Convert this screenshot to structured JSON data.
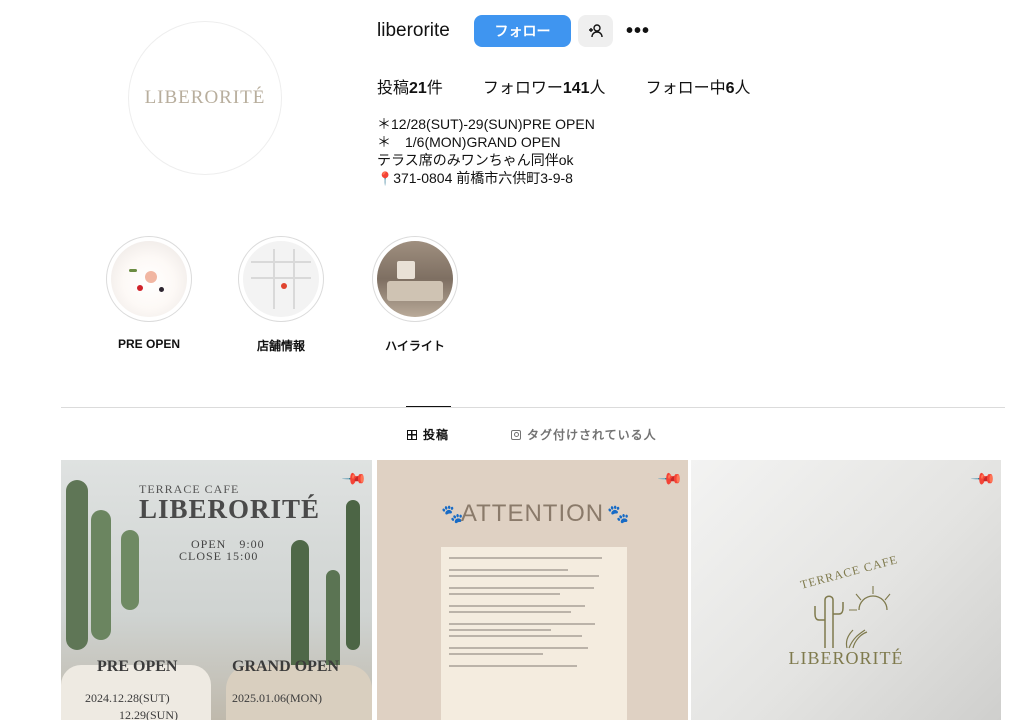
{
  "profile": {
    "avatar_text": "LIBERORITÉ",
    "username": "liberorite",
    "follow_label": "フォロー",
    "add_user_icon": "add-person-icon",
    "more_label": "•••",
    "stats": {
      "posts_prefix": "投稿",
      "posts_count": "21",
      "posts_suffix": "件",
      "followers_prefix": "フォロワー",
      "followers_count": "141",
      "followers_suffix": "人",
      "following_prefix": "フォロー中",
      "following_count": "6",
      "following_suffix": "人"
    },
    "bio": [
      "＊12/28(SUT)-29(SUN)PRE OPEN",
      "＊　1/6(MON)GRAND OPEN",
      "テラス席のみワンちゃん同伴ok",
      "371-0804 前橋市六供町3-9-8"
    ],
    "bio_pin": "📍"
  },
  "highlights": [
    {
      "label": "PRE OPEN"
    },
    {
      "label": "店舗情報"
    },
    {
      "label": "ハイライト"
    }
  ],
  "tabs": {
    "posts_label": "投稿",
    "tagged_label": "タグ付けされている人",
    "active": "posts"
  },
  "posts": [
    {
      "terrace": "TERRACE CAFE",
      "brand": "LIBERORITÉ",
      "open": "OPEN　9:00",
      "close": "CLOSE 15:00",
      "pre_open": "PRE OPEN",
      "grand_open": "GRAND OPEN",
      "pre_date1": "2024.12.28(SUT)",
      "pre_date2": "12.29(SUN)",
      "grand_date": "2025.01.06(MON)"
    },
    {
      "title": "ATTENTION"
    },
    {
      "terrace": "TERRACE CAFE",
      "brand": "LIBERORITÉ"
    }
  ],
  "colors": {
    "follow_button": "#3f95f0",
    "text": "#111111",
    "muted": "#737373",
    "divider": "#dbdbdb"
  }
}
